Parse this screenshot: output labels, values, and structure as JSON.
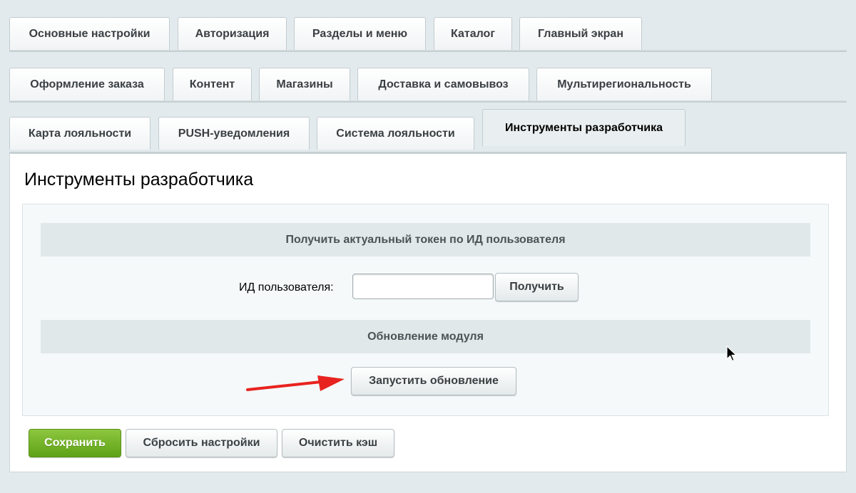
{
  "tabs": {
    "row1": [
      "Основные настройки",
      "Авторизация",
      "Разделы и меню",
      "Каталог",
      "Главный экран"
    ],
    "row2": [
      "Оформление заказа",
      "Контент",
      "Магазины",
      "Доставка и самовывоз",
      "Мультирегиональность"
    ],
    "row3": [
      "Карта лояльности",
      "PUSH-уведомления",
      "Система лояльности",
      "Инструменты разработчика"
    ],
    "active": "Инструменты разработчика"
  },
  "page": {
    "title": "Инструменты разработчика"
  },
  "token_section": {
    "heading": "Получить актуальный токен по ИД пользователя",
    "user_id_label": "ИД пользователя:",
    "user_id_value": "",
    "get_button": "Получить"
  },
  "update_section": {
    "heading": "Обновление модуля",
    "run_update_button": "Запустить обновление"
  },
  "footer": {
    "save_button": "Сохранить",
    "reset_button": "Сбросить настройки",
    "clear_cache_button": "Очистить кэш"
  },
  "colors": {
    "accent_green": "#6cb022",
    "annotation_arrow": "#e8231f"
  }
}
